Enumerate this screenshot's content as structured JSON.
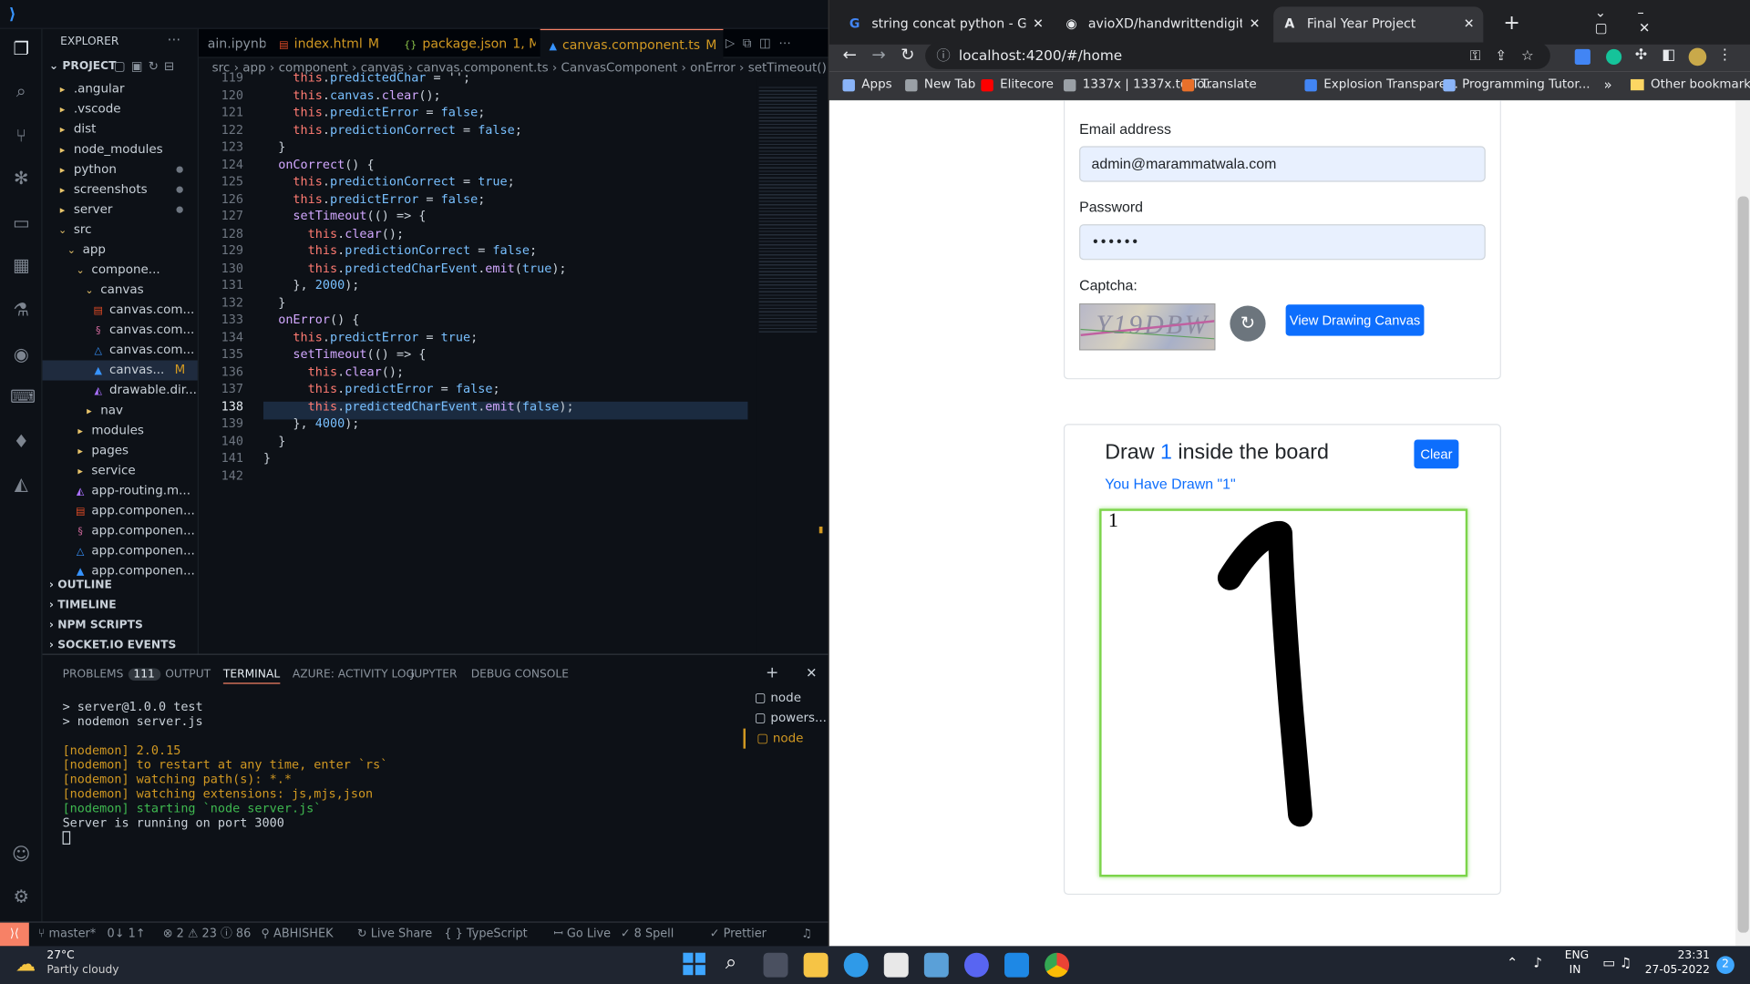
{
  "vscode": {
    "explorer_header": "EXPLORER",
    "project_label": "PROJECT",
    "tree": [
      {
        "label": ".angular",
        "kind": "folder",
        "depth": 1
      },
      {
        "label": ".vscode",
        "kind": "folder",
        "depth": 1
      },
      {
        "label": "dist",
        "kind": "folder",
        "depth": 1
      },
      {
        "label": "node_modules",
        "kind": "folder",
        "depth": 1
      },
      {
        "label": "python",
        "kind": "folder",
        "depth": 1
      },
      {
        "label": "screenshots",
        "kind": "folder",
        "depth": 1
      },
      {
        "label": "server",
        "kind": "folder",
        "depth": 1
      },
      {
        "label": "src",
        "kind": "folder-open",
        "depth": 1
      },
      {
        "label": "app",
        "kind": "folder-open",
        "depth": 2
      },
      {
        "label": "compone...",
        "kind": "folder-open",
        "depth": 3
      },
      {
        "label": "canvas",
        "kind": "folder-open",
        "depth": 4
      },
      {
        "label": "canvas.com...",
        "kind": "html",
        "depth": 5
      },
      {
        "label": "canvas.com...",
        "kind": "scss",
        "depth": 5
      },
      {
        "label": "canvas.com...",
        "kind": "spec",
        "depth": 5
      },
      {
        "label": "canvas...",
        "kind": "ts",
        "depth": 5,
        "badge": "M"
      },
      {
        "label": "drawable.dir...",
        "kind": "angular",
        "depth": 5
      },
      {
        "label": "nav",
        "kind": "folder",
        "depth": 4
      },
      {
        "label": "modules",
        "kind": "folder",
        "depth": 3
      },
      {
        "label": "pages",
        "kind": "folder",
        "depth": 3
      },
      {
        "label": "service",
        "kind": "folder",
        "depth": 3
      },
      {
        "label": "app-routing.m...",
        "kind": "angular",
        "depth": 3
      },
      {
        "label": "app.componen...",
        "kind": "html",
        "depth": 3
      },
      {
        "label": "app.componen...",
        "kind": "scss",
        "depth": 3
      },
      {
        "label": "app.componen...",
        "kind": "spec",
        "depth": 3
      },
      {
        "label": "app.componen...",
        "kind": "ts",
        "depth": 3
      }
    ],
    "sections": [
      "OUTLINE",
      "TIMELINE",
      "NPM SCRIPTS",
      "SOCKET.IO EVENTS"
    ],
    "tabs": [
      {
        "label": "ain.ipynb",
        "badge": ""
      },
      {
        "label": "index.html",
        "badge": "M"
      },
      {
        "label": "package.json",
        "badge": "1, M"
      },
      {
        "label": "canvas.component.ts",
        "badge": "M"
      }
    ],
    "breadcrumb": "src › app › component › canvas › canvas.component.ts › CanvasComponent › onError › setTimeout()",
    "code_lines": [
      {
        "n": "119",
        "t": "    this.predictedChar = '';"
      },
      {
        "n": "120",
        "t": "    this.canvas.clear();"
      },
      {
        "n": "121",
        "t": "    this.predictError = false;"
      },
      {
        "n": "122",
        "t": "    this.predictionCorrect = false;"
      },
      {
        "n": "123",
        "t": "  }"
      },
      {
        "n": "124",
        "t": "  onCorrect() {"
      },
      {
        "n": "125",
        "t": "    this.predictionCorrect = true;"
      },
      {
        "n": "126",
        "t": "    this.predictError = false;"
      },
      {
        "n": "127",
        "t": "    setTimeout(() => {"
      },
      {
        "n": "128",
        "t": "      this.clear();"
      },
      {
        "n": "129",
        "t": "      this.predictionCorrect = false;"
      },
      {
        "n": "130",
        "t": "      this.predictedCharEvent.emit(true);"
      },
      {
        "n": "131",
        "t": "    }, 2000);"
      },
      {
        "n": "132",
        "t": "  }"
      },
      {
        "n": "133",
        "t": "  onError() {"
      },
      {
        "n": "134",
        "t": "    this.predictError = true;"
      },
      {
        "n": "135",
        "t": "    setTimeout(() => {"
      },
      {
        "n": "136",
        "t": "      this.clear();"
      },
      {
        "n": "137",
        "t": "      this.predictError = false;"
      },
      {
        "n": "138",
        "t": "      this.predictedCharEvent.emit(false);"
      },
      {
        "n": "139",
        "t": "    }, 4000);"
      },
      {
        "n": "140",
        "t": "  }"
      },
      {
        "n": "141",
        "t": "}"
      },
      {
        "n": "142",
        "t": ""
      }
    ],
    "panel_tabs": [
      "PROBLEMS",
      "OUTPUT",
      "TERMINAL",
      "AZURE: ACTIVITY LOG",
      "JUPYTER",
      "DEBUG CONSOLE"
    ],
    "problems_count": "111",
    "terminal_lines": [
      {
        "t": "> server@1.0.0 test",
        "c": "#c9d1d9"
      },
      {
        "t": "> nodemon server.js",
        "c": "#c9d1d9"
      },
      {
        "t": "",
        "c": "#c9d1d9"
      },
      {
        "t": "[nodemon] 2.0.15",
        "c": "#d29922"
      },
      {
        "t": "[nodemon] to restart at any time, enter `rs`",
        "c": "#d29922"
      },
      {
        "t": "[nodemon] watching path(s): *.*",
        "c": "#d29922"
      },
      {
        "t": "[nodemon] watching extensions: js,mjs,json",
        "c": "#d29922"
      },
      {
        "t": "[nodemon] starting `node server.js`",
        "c": "#3fb950"
      },
      {
        "t": "Server is running on port 3000",
        "c": "#c9d1d9"
      }
    ],
    "terminals": [
      "node",
      "powers...",
      "node"
    ],
    "status": {
      "branch": "master*",
      "sync": "0↓ 1↑",
      "problems": "⊗ 2 ⚠ 23 ⓘ 86",
      "user": "ABHISHEK",
      "liveshare": "Live Share",
      "lang": "TypeScript",
      "golive": "Go Live",
      "spell": "8 Spell",
      "prettier": "Prettier"
    }
  },
  "chrome": {
    "tabs": [
      {
        "label": "string concat python - Google Se"
      },
      {
        "label": "avioXD/handwrittendigitrecognit"
      },
      {
        "label": "Final Year Project"
      }
    ],
    "url": "localhost:4200/#/home",
    "bookmarks": [
      "Apps",
      "New Tab",
      "Elitecore",
      "1337x | 1337x.to To...",
      "Translate",
      "Explosion Transpare...",
      "Programming Tutor..."
    ],
    "other_bookmarks": "Other bookmarks",
    "form": {
      "email_label": "Email address",
      "email_value": "admin@marammatwala.com",
      "password_label": "Password",
      "password_value": "••••••",
      "captcha_label": "Captcha:",
      "captcha_text": "Y19DBW",
      "view_canvas_button": "View Drawing Canvas"
    },
    "board": {
      "title_prefix": "Draw",
      "target_digit": "1",
      "title_suffix": "inside the board",
      "clear_button": "Clear",
      "drawn_message": "You Have Drawn \"1\"",
      "drawn_char": "1"
    }
  },
  "taskbar": {
    "temperature": "27°C",
    "weather": "Partly cloudy",
    "lang": "ENG",
    "region": "IN",
    "time": "23:31",
    "date": "27-05-2022",
    "notifications": "2"
  }
}
